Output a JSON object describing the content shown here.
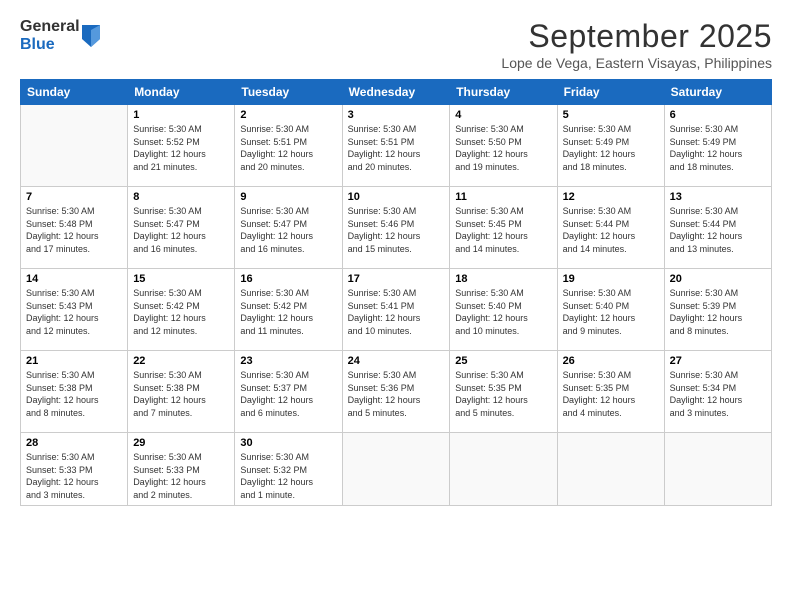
{
  "logo": {
    "general": "General",
    "blue": "Blue"
  },
  "title": "September 2025",
  "subtitle": "Lope de Vega, Eastern Visayas, Philippines",
  "days": [
    "Sunday",
    "Monday",
    "Tuesday",
    "Wednesday",
    "Thursday",
    "Friday",
    "Saturday"
  ],
  "weeks": [
    [
      {
        "day": "",
        "info": ""
      },
      {
        "day": "1",
        "info": "Sunrise: 5:30 AM\nSunset: 5:52 PM\nDaylight: 12 hours\nand 21 minutes."
      },
      {
        "day": "2",
        "info": "Sunrise: 5:30 AM\nSunset: 5:51 PM\nDaylight: 12 hours\nand 20 minutes."
      },
      {
        "day": "3",
        "info": "Sunrise: 5:30 AM\nSunset: 5:51 PM\nDaylight: 12 hours\nand 20 minutes."
      },
      {
        "day": "4",
        "info": "Sunrise: 5:30 AM\nSunset: 5:50 PM\nDaylight: 12 hours\nand 19 minutes."
      },
      {
        "day": "5",
        "info": "Sunrise: 5:30 AM\nSunset: 5:49 PM\nDaylight: 12 hours\nand 18 minutes."
      },
      {
        "day": "6",
        "info": "Sunrise: 5:30 AM\nSunset: 5:49 PM\nDaylight: 12 hours\nand 18 minutes."
      }
    ],
    [
      {
        "day": "7",
        "info": "Sunrise: 5:30 AM\nSunset: 5:48 PM\nDaylight: 12 hours\nand 17 minutes."
      },
      {
        "day": "8",
        "info": "Sunrise: 5:30 AM\nSunset: 5:47 PM\nDaylight: 12 hours\nand 16 minutes."
      },
      {
        "day": "9",
        "info": "Sunrise: 5:30 AM\nSunset: 5:47 PM\nDaylight: 12 hours\nand 16 minutes."
      },
      {
        "day": "10",
        "info": "Sunrise: 5:30 AM\nSunset: 5:46 PM\nDaylight: 12 hours\nand 15 minutes."
      },
      {
        "day": "11",
        "info": "Sunrise: 5:30 AM\nSunset: 5:45 PM\nDaylight: 12 hours\nand 14 minutes."
      },
      {
        "day": "12",
        "info": "Sunrise: 5:30 AM\nSunset: 5:44 PM\nDaylight: 12 hours\nand 14 minutes."
      },
      {
        "day": "13",
        "info": "Sunrise: 5:30 AM\nSunset: 5:44 PM\nDaylight: 12 hours\nand 13 minutes."
      }
    ],
    [
      {
        "day": "14",
        "info": "Sunrise: 5:30 AM\nSunset: 5:43 PM\nDaylight: 12 hours\nand 12 minutes."
      },
      {
        "day": "15",
        "info": "Sunrise: 5:30 AM\nSunset: 5:42 PM\nDaylight: 12 hours\nand 12 minutes."
      },
      {
        "day": "16",
        "info": "Sunrise: 5:30 AM\nSunset: 5:42 PM\nDaylight: 12 hours\nand 11 minutes."
      },
      {
        "day": "17",
        "info": "Sunrise: 5:30 AM\nSunset: 5:41 PM\nDaylight: 12 hours\nand 10 minutes."
      },
      {
        "day": "18",
        "info": "Sunrise: 5:30 AM\nSunset: 5:40 PM\nDaylight: 12 hours\nand 10 minutes."
      },
      {
        "day": "19",
        "info": "Sunrise: 5:30 AM\nSunset: 5:40 PM\nDaylight: 12 hours\nand 9 minutes."
      },
      {
        "day": "20",
        "info": "Sunrise: 5:30 AM\nSunset: 5:39 PM\nDaylight: 12 hours\nand 8 minutes."
      }
    ],
    [
      {
        "day": "21",
        "info": "Sunrise: 5:30 AM\nSunset: 5:38 PM\nDaylight: 12 hours\nand 8 minutes."
      },
      {
        "day": "22",
        "info": "Sunrise: 5:30 AM\nSunset: 5:38 PM\nDaylight: 12 hours\nand 7 minutes."
      },
      {
        "day": "23",
        "info": "Sunrise: 5:30 AM\nSunset: 5:37 PM\nDaylight: 12 hours\nand 6 minutes."
      },
      {
        "day": "24",
        "info": "Sunrise: 5:30 AM\nSunset: 5:36 PM\nDaylight: 12 hours\nand 5 minutes."
      },
      {
        "day": "25",
        "info": "Sunrise: 5:30 AM\nSunset: 5:35 PM\nDaylight: 12 hours\nand 5 minutes."
      },
      {
        "day": "26",
        "info": "Sunrise: 5:30 AM\nSunset: 5:35 PM\nDaylight: 12 hours\nand 4 minutes."
      },
      {
        "day": "27",
        "info": "Sunrise: 5:30 AM\nSunset: 5:34 PM\nDaylight: 12 hours\nand 3 minutes."
      }
    ],
    [
      {
        "day": "28",
        "info": "Sunrise: 5:30 AM\nSunset: 5:33 PM\nDaylight: 12 hours\nand 3 minutes."
      },
      {
        "day": "29",
        "info": "Sunrise: 5:30 AM\nSunset: 5:33 PM\nDaylight: 12 hours\nand 2 minutes."
      },
      {
        "day": "30",
        "info": "Sunrise: 5:30 AM\nSunset: 5:32 PM\nDaylight: 12 hours\nand 1 minute."
      },
      {
        "day": "",
        "info": ""
      },
      {
        "day": "",
        "info": ""
      },
      {
        "day": "",
        "info": ""
      },
      {
        "day": "",
        "info": ""
      }
    ]
  ]
}
